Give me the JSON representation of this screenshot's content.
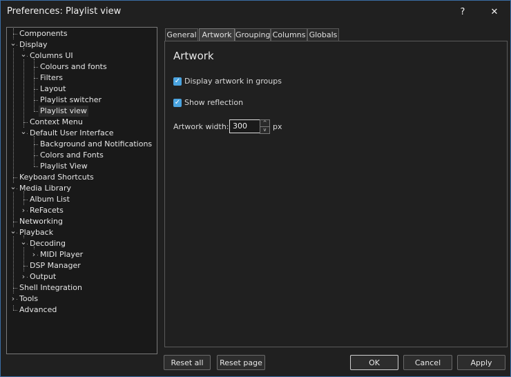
{
  "window": {
    "title": "Preferences: Playlist view",
    "help_glyph": "?",
    "close_glyph": "✕"
  },
  "tree": {
    "items": [
      {
        "label": "Components",
        "level": 0,
        "expander": ""
      },
      {
        "label": "Display",
        "level": 0,
        "expander": "v"
      },
      {
        "label": "Columns UI",
        "level": 1,
        "expander": "v"
      },
      {
        "label": "Colours and fonts",
        "level": 2,
        "expander": ""
      },
      {
        "label": "Filters",
        "level": 2,
        "expander": ""
      },
      {
        "label": "Layout",
        "level": 2,
        "expander": ""
      },
      {
        "label": "Playlist switcher",
        "level": 2,
        "expander": ""
      },
      {
        "label": "Playlist view",
        "level": 2,
        "expander": "",
        "selected": true
      },
      {
        "label": "Context Menu",
        "level": 1,
        "expander": ""
      },
      {
        "label": "Default User Interface",
        "level": 1,
        "expander": "v"
      },
      {
        "label": "Background and Notifications",
        "level": 2,
        "expander": ""
      },
      {
        "label": "Colors and Fonts",
        "level": 2,
        "expander": ""
      },
      {
        "label": "Playlist View",
        "level": 2,
        "expander": ""
      },
      {
        "label": "Keyboard Shortcuts",
        "level": 0,
        "expander": ""
      },
      {
        "label": "Media Library",
        "level": 0,
        "expander": "v"
      },
      {
        "label": "Album List",
        "level": 1,
        "expander": ""
      },
      {
        "label": "ReFacets",
        "level": 1,
        "expander": ">"
      },
      {
        "label": "Networking",
        "level": 0,
        "expander": ""
      },
      {
        "label": "Playback",
        "level": 0,
        "expander": "v"
      },
      {
        "label": "Decoding",
        "level": 1,
        "expander": "v"
      },
      {
        "label": "MIDI Player",
        "level": 2,
        "expander": ">"
      },
      {
        "label": "DSP Manager",
        "level": 1,
        "expander": ""
      },
      {
        "label": "Output",
        "level": 1,
        "expander": ">"
      },
      {
        "label": "Shell Integration",
        "level": 0,
        "expander": ""
      },
      {
        "label": "Tools",
        "level": 0,
        "expander": ">"
      },
      {
        "label": "Advanced",
        "level": 0,
        "expander": ""
      }
    ]
  },
  "tabs": [
    {
      "label": "General",
      "active": false
    },
    {
      "label": "Artwork",
      "active": true
    },
    {
      "label": "Grouping",
      "active": false
    },
    {
      "label": "Columns",
      "active": false
    },
    {
      "label": "Globals",
      "active": false
    }
  ],
  "panel": {
    "title": "Artwork",
    "display_artwork_label": "Display artwork in groups",
    "display_artwork_checked": true,
    "show_reflection_label": "Show reflection",
    "show_reflection_checked": true,
    "artwork_width_label": "Artwork width:",
    "artwork_width_value": "300",
    "artwork_width_unit": "px",
    "spin_up": "^",
    "spin_down": "v"
  },
  "buttons": {
    "reset_all": "Reset all",
    "reset_page": "Reset page",
    "ok": "OK",
    "cancel": "Cancel",
    "apply": "Apply"
  },
  "colors": {
    "accent": "#4aa3df",
    "background": "#202020",
    "window_border": "#3a6ea5"
  }
}
